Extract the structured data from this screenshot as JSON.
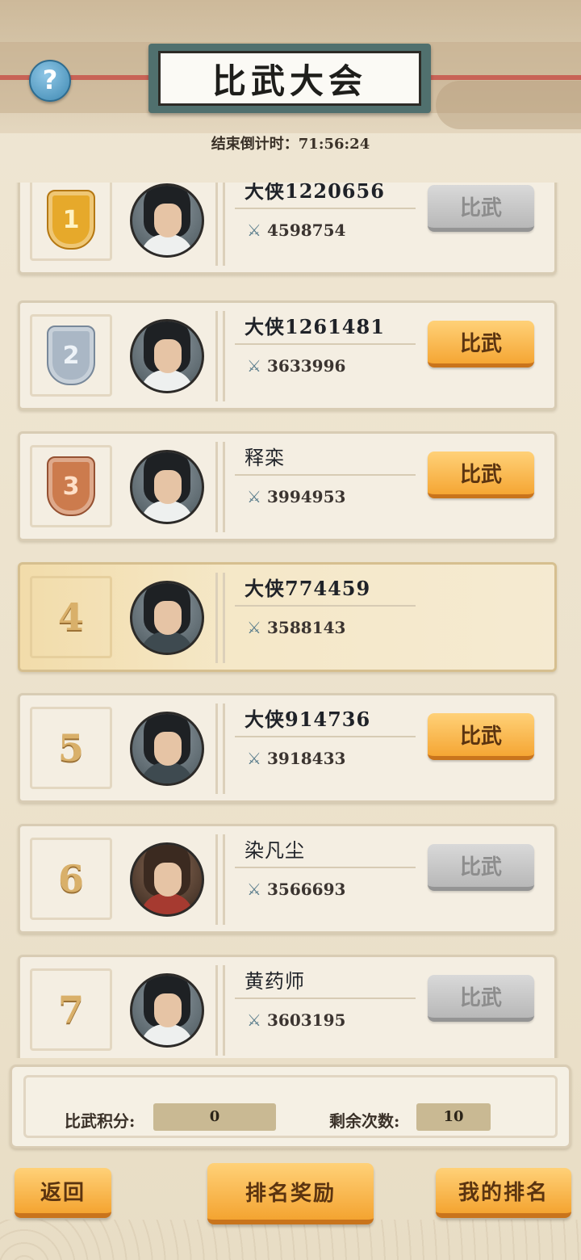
{
  "header": {
    "title": "比武大会",
    "help_glyph": "?",
    "countdown": "结束倒计时：71:56:24"
  },
  "rows": [
    {
      "rank": "1",
      "medal": "gold",
      "name": "大侠1220656",
      "power": "4598754",
      "button": "比武",
      "button_state": "disabled",
      "avatar": "swordsman-white"
    },
    {
      "rank": "2",
      "medal": "silver",
      "name": "大侠1261481",
      "power": "3633996",
      "button": "比武",
      "button_state": "active",
      "avatar": "swordsman-white"
    },
    {
      "rank": "3",
      "medal": "bronze",
      "name": "释栾",
      "power": "3994953",
      "button": "比武",
      "button_state": "active",
      "avatar": "swordsman-white"
    },
    {
      "rank": "4",
      "medal": "none",
      "name": "大侠774459",
      "power": "3588143",
      "button": "",
      "button_state": "none",
      "avatar": "swordsman-dark",
      "is_self": true
    },
    {
      "rank": "5",
      "medal": "none",
      "name": "大侠914736",
      "power": "3918433",
      "button": "比武",
      "button_state": "active",
      "avatar": "swordsman-dark"
    },
    {
      "rank": "6",
      "medal": "none",
      "name": "染凡尘",
      "power": "3566693",
      "button": "比武",
      "button_state": "disabled",
      "avatar": "warrior-red"
    },
    {
      "rank": "7",
      "medal": "none",
      "name": "黄药师",
      "power": "3603195",
      "button": "比武",
      "button_state": "disabled",
      "avatar": "swordsman-white"
    }
  ],
  "stats": {
    "score_label": "比武积分:",
    "score_value": "0",
    "remaining_label": "剩余次数:",
    "remaining_value": "10"
  },
  "footer": {
    "back": "返回",
    "rewards": "排名奖励",
    "my_rank": "我的排名"
  },
  "icons": {
    "power": "crossed-swords-icon",
    "help": "question-icon"
  },
  "colors": {
    "active_button": "#f5a634",
    "disabled_button": "#b8b8b8",
    "title_frame": "#50706e"
  }
}
